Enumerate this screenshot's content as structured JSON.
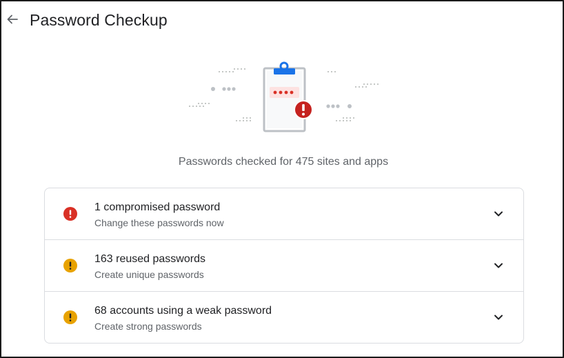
{
  "header": {
    "title": "Password Checkup",
    "back_icon": "arrow-back-icon"
  },
  "illustration": {
    "dots": "••••",
    "icon": "clipboard-password-warning-icon"
  },
  "summary": {
    "text": "Passwords checked for 475 sites and apps"
  },
  "colors": {
    "error_red": "#d93025",
    "warning_amber": "#e8a200",
    "accent_blue": "#1a73e8"
  },
  "items": [
    {
      "title": "1 compromised password",
      "subtitle": "Change these passwords now",
      "icon": "error-icon",
      "status": "error"
    },
    {
      "title": "163 reused passwords",
      "subtitle": "Create unique passwords",
      "icon": "warning-icon",
      "status": "warning"
    },
    {
      "title": "68 accounts using a weak password",
      "subtitle": "Create strong passwords",
      "icon": "warning-icon",
      "status": "warning"
    }
  ]
}
